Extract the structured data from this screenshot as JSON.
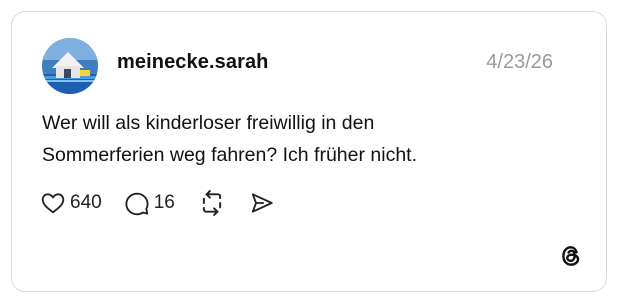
{
  "post": {
    "username": "meinecke.sarah",
    "date": "4/23/26",
    "text_lines": [
      "Wer will als kinderloser freiwillig in den",
      "Sommerferien weg fahren? Ich früher nicht."
    ]
  },
  "actions": {
    "like_count": "640",
    "comment_count": "16"
  },
  "icons": {
    "like": "heart-outline-icon",
    "comment": "speech-bubble-icon",
    "repost": "repost-arrows-icon",
    "share": "paper-plane-icon",
    "brand": "threads-logo-icon"
  },
  "colors": {
    "border": "#d9d9d9",
    "date": "#9a9a9a",
    "text": "#111111"
  }
}
